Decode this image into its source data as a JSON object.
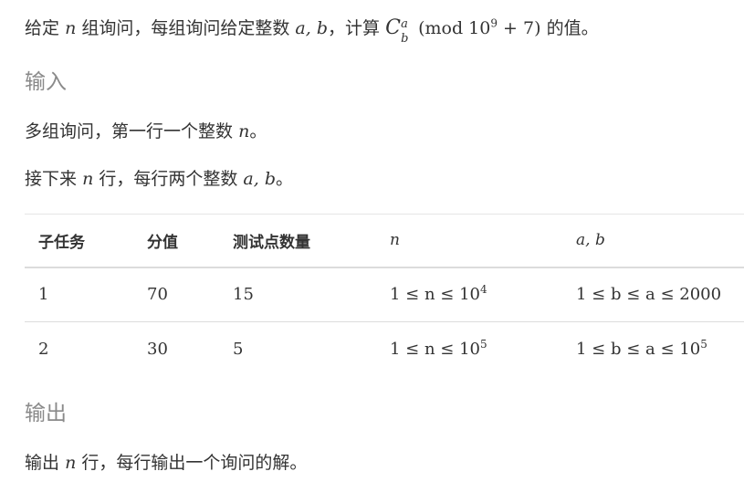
{
  "statement": {
    "p1_pre": "给定",
    "p1_n": "n",
    "p1_mid": "组询问，每组询问给定整数",
    "p1_ab": "a, b",
    "p1_post1": "，计算",
    "p1_C": "C",
    "p1_Csup": "a",
    "p1_Csub": "b",
    "p1_mod_open": "(mod 10",
    "p1_mod_exp": "9",
    "p1_mod_close": "+ 7)",
    "p1_post2": "的值。"
  },
  "input": {
    "heading": "输入",
    "line1_pre": "多组询问，第一行一个整数",
    "line1_n": "n",
    "line1_post": "。",
    "line2_pre": "接下来",
    "line2_n": "n",
    "line2_mid": "行，每行两个整数",
    "line2_ab": "a, b",
    "line2_post": "。"
  },
  "table": {
    "headers": [
      "子任务",
      "分值",
      "测试点数量",
      "n",
      "a, b"
    ],
    "rows": [
      {
        "subtask": "1",
        "score": "70",
        "count": "15",
        "n_range": "1 ≤ n ≤ 10",
        "n_exp": "4",
        "ab_range": "1 ≤ b ≤ a ≤ 2000",
        "ab_exp": ""
      },
      {
        "subtask": "2",
        "score": "30",
        "count": "5",
        "n_range": "1 ≤ n ≤ 10",
        "n_exp": "5",
        "ab_range": "1 ≤ b ≤ a ≤ 10",
        "ab_exp": "5"
      }
    ]
  },
  "output": {
    "heading": "输出",
    "line_pre": "输出",
    "line_n": "n",
    "line_post": "行，每行输出一个询问的解。"
  }
}
